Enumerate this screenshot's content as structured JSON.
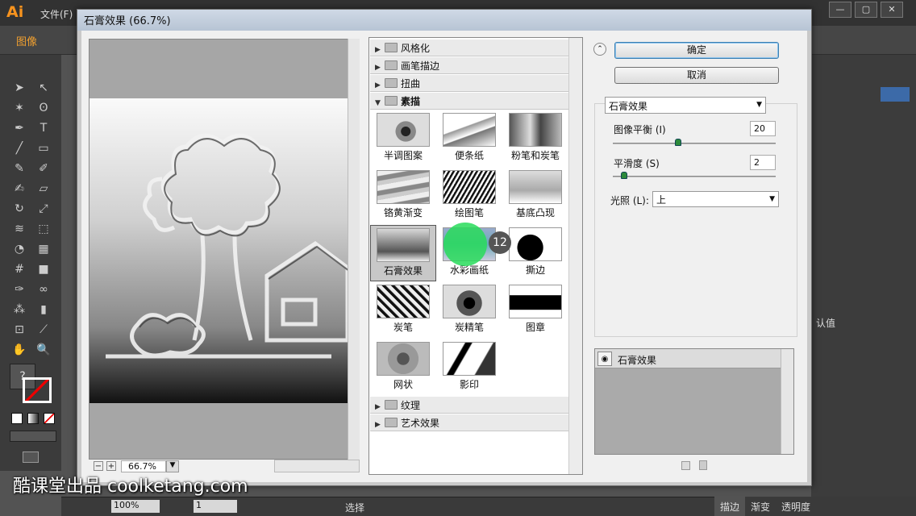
{
  "app": {
    "logo": "Ai",
    "menu_file": "文件(F)",
    "window_buttons": [
      "—",
      "▢",
      "✕"
    ]
  },
  "control_bar": {
    "label": "图像"
  },
  "dialog": {
    "title": "石膏效果 (66.7%)",
    "ok_label": "确定",
    "cancel_label": "取消",
    "zoom_value": "66.7%",
    "categories_top": [
      {
        "label": "风格化",
        "open": false
      },
      {
        "label": "画笔描边",
        "open": false
      },
      {
        "label": "扭曲",
        "open": false
      },
      {
        "label": "素描",
        "open": true
      }
    ],
    "sketch_filters": [
      {
        "label": "半调图案",
        "selected": false
      },
      {
        "label": "便条纸",
        "selected": false
      },
      {
        "label": "粉笔和炭笔",
        "selected": false
      },
      {
        "label": "铬黄渐变",
        "selected": false
      },
      {
        "label": "绘图笔",
        "selected": false
      },
      {
        "label": "基底凸现",
        "selected": false
      },
      {
        "label": "石膏效果",
        "selected": true
      },
      {
        "label": "水彩画纸",
        "selected": false
      },
      {
        "label": "撕边",
        "selected": false
      },
      {
        "label": "炭笔",
        "selected": false
      },
      {
        "label": "炭精笔",
        "selected": false
      },
      {
        "label": "图章",
        "selected": false
      },
      {
        "label": "网状",
        "selected": false
      },
      {
        "label": "影印",
        "selected": false
      }
    ],
    "categories_bottom": [
      {
        "label": "纹理",
        "open": false
      },
      {
        "label": "艺术效果",
        "open": false
      }
    ],
    "click_badge": "12",
    "settings": {
      "filter_select": "石膏效果",
      "image_balance": {
        "label": "图像平衡 (I)",
        "value": "20",
        "fraction": 0.4
      },
      "smoothness": {
        "label": "平滑度 (S)",
        "value": "2",
        "fraction": 0.07
      },
      "light": {
        "label": "光照 (L):",
        "value": "上"
      }
    },
    "effect_layer": {
      "name": "石膏效果"
    }
  },
  "right_panel": {
    "text": "认值"
  },
  "status_bar": {
    "zoom": "100%",
    "page": "1",
    "tool": "选择"
  },
  "bottom_tabs": [
    "描边",
    "渐变",
    "透明度"
  ],
  "watermark": "酷课堂出品 coolketang.com",
  "tool_icons": [
    "selection-arrow-icon",
    "direct-selection-icon",
    "magic-wand-icon",
    "lasso-icon",
    "pen-icon",
    "type-icon",
    "line-icon",
    "rectangle-icon",
    "paintbrush-icon",
    "pencil-icon",
    "blob-brush-icon",
    "eraser-icon",
    "rotate-icon",
    "scale-icon",
    "width-icon",
    "free-transform-icon",
    "shape-builder-icon",
    "perspective-icon",
    "mesh-icon",
    "gradient-icon",
    "eyedropper-icon",
    "blend-icon",
    "symbol-sprayer-icon",
    "column-graph-icon",
    "artboard-icon",
    "slice-icon",
    "hand-icon",
    "zoom-icon"
  ]
}
